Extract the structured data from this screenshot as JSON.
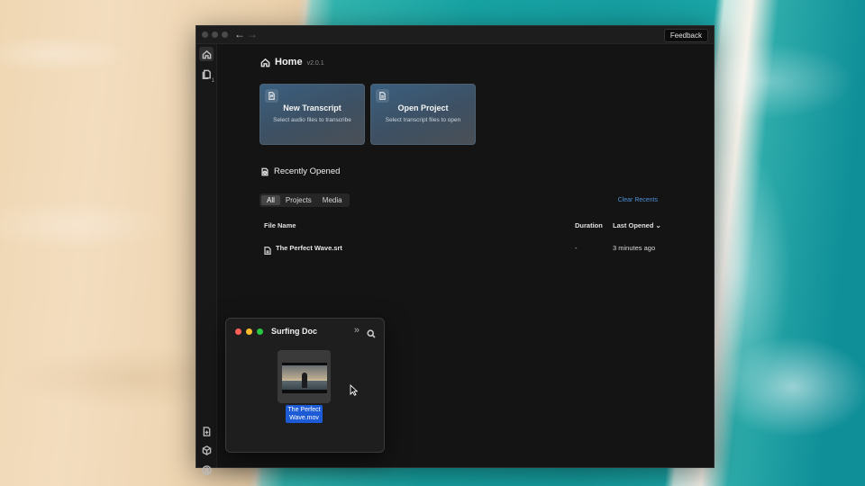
{
  "app": {
    "feedback_label": "Feedback",
    "sidebar": {
      "recent_badge": "1"
    },
    "home": {
      "title": "Home",
      "version": "v2.0.1"
    },
    "cards": [
      {
        "title": "New Transcript",
        "subtitle": "Select audio files to transcribe",
        "icon": "audio-file-icon"
      },
      {
        "title": "Open Project",
        "subtitle": "Select transcript files to open",
        "icon": "document-icon"
      }
    ],
    "recent": {
      "title": "Recently Opened",
      "tabs": [
        {
          "label": "All",
          "active": true
        },
        {
          "label": "Projects",
          "active": false
        },
        {
          "label": "Media",
          "active": false
        }
      ],
      "clear_label": "Clear Recents",
      "columns": {
        "name": "File Name",
        "duration": "Duration",
        "last_opened": "Last Opened"
      },
      "rows": [
        {
          "name": "The Perfect Wave.srt",
          "duration": "-",
          "last_opened": "3 minutes ago"
        }
      ]
    }
  },
  "finder": {
    "title": "Surfing Doc",
    "file": {
      "name_line1": "The Perfect",
      "name_line2": "Wave.mov"
    }
  },
  "colors": {
    "accent": "#4e8fd6",
    "selection": "#1d5bd6",
    "traffic_red": "#ff5f57",
    "traffic_yellow": "#febc2e",
    "traffic_green": "#28c840"
  }
}
